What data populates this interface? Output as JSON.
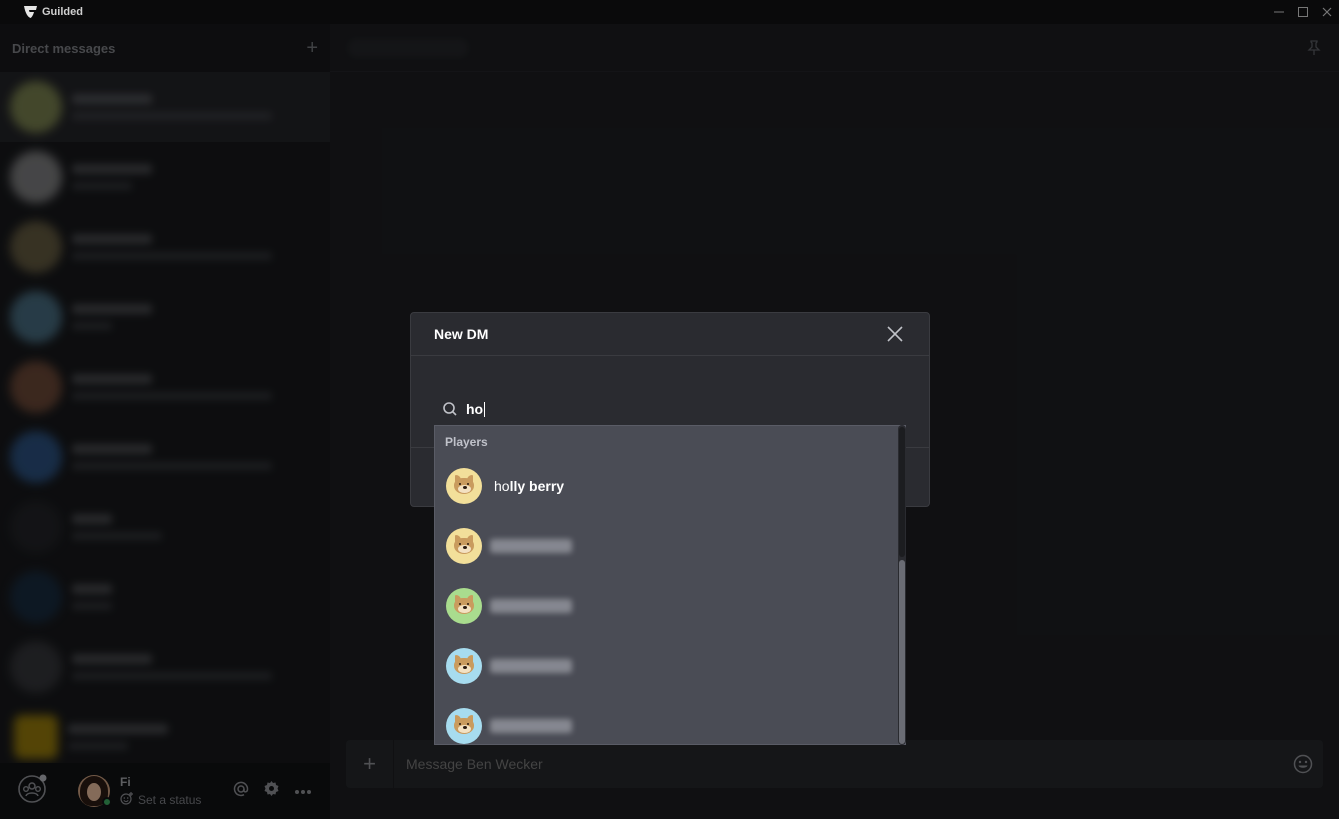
{
  "window": {
    "app_title": "Guilded"
  },
  "sidebar": {
    "title": "Direct messages",
    "add_label": "+"
  },
  "user_bar": {
    "name": "Fi",
    "status_label": "Set a status"
  },
  "composer": {
    "add_label": "+",
    "placeholder": "Message Ben Wecker"
  },
  "modal": {
    "title": "New DM",
    "search_value": "ho",
    "dropdown": {
      "section_label": "Players",
      "items": [
        {
          "name_match": "ho",
          "name_rest": "lly berry",
          "avatar_color": "#f2df9a"
        },
        {
          "avatar_color": "#f2df9a"
        },
        {
          "avatar_color": "#a9dc8e"
        },
        {
          "avatar_color": "#a7dcef"
        },
        {
          "avatar_color": "#a7dcef"
        }
      ]
    }
  },
  "colors": {
    "accent_yellow": "#f5c400",
    "online_green": "#3ba55d"
  }
}
